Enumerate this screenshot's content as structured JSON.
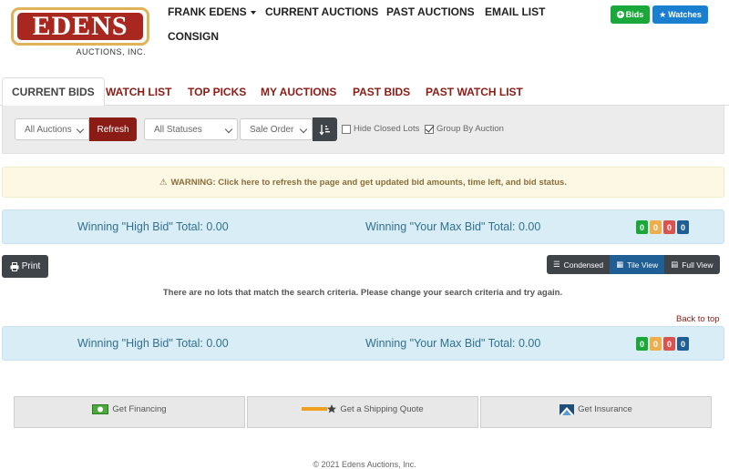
{
  "brand": {
    "logo_text": "EDENS",
    "logo_sub": "AUCTIONS, INC."
  },
  "topnav": {
    "items": [
      "FRANK EDENS",
      "CURRENT AUCTIONS",
      "PAST AUCTIONS",
      "EMAIL LIST",
      "CONSIGN"
    ]
  },
  "header_buttons": {
    "bids": "Bids",
    "watches": "Watches"
  },
  "tabs": [
    "CURRENT BIDS",
    "WATCH LIST",
    "TOP PICKS",
    "MY AUCTIONS",
    "PAST BIDS",
    "PAST WATCH LIST"
  ],
  "filters": {
    "auction_select": "All Auctions",
    "refresh": "Refresh",
    "status_select": "All Statuses",
    "sort_select": "Sale Order",
    "hide_closed": "Hide Closed Lots",
    "group_by": "Group By Auction"
  },
  "warning": "WARNING: Click here to refresh the page and get updated bid amounts, time left, and bid status.",
  "totals": {
    "high_bid": "Winning \"High Bid\" Total: 0.00",
    "max_bid": "Winning \"Your Max Bid\" Total: 0.00",
    "badges": [
      {
        "value": "0",
        "color": "#1aa83a"
      },
      {
        "value": "0",
        "color": "#f0ad4e"
      },
      {
        "value": "0",
        "color": "#d9534f"
      },
      {
        "value": "0",
        "color": "#1f5f96"
      }
    ]
  },
  "print": "Print",
  "views": [
    "Condensed",
    "Tile View",
    "Full View"
  ],
  "no_lots": "There are no lots that match the search criteria. Please change your search criteria and try again.",
  "back_to_top": "Back to top",
  "services": [
    "Get Financing",
    "Get a Shipping Quote",
    "Get Insurance"
  ],
  "footer": "© 2021 Edens Auctions, Inc."
}
